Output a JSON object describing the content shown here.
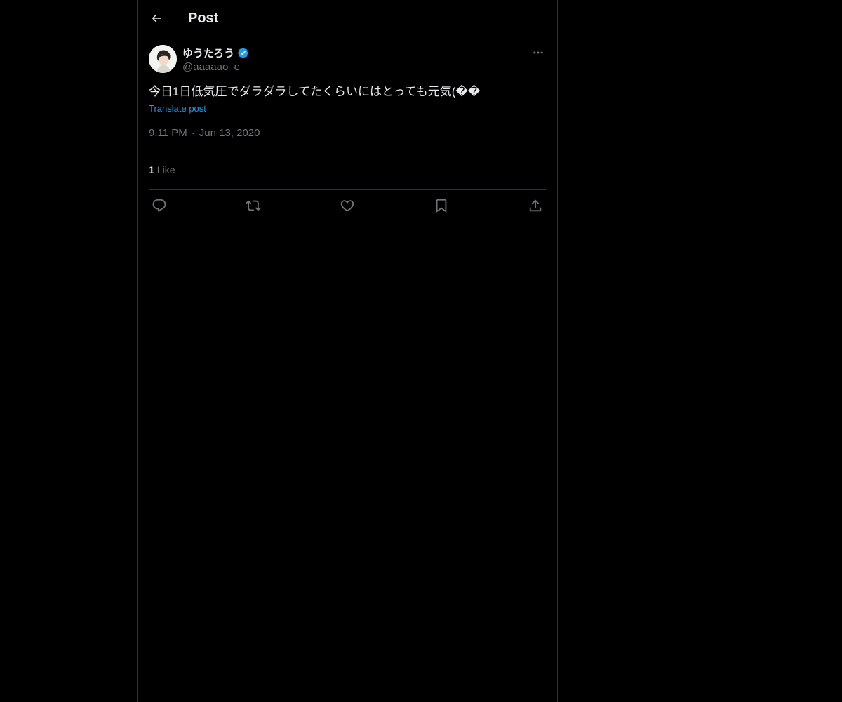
{
  "header": {
    "title": "Post",
    "back_icon": "arrow-left-icon"
  },
  "post": {
    "author": {
      "display_name": "ゆうたろう",
      "handle": "@aaaaao_e",
      "verified": true,
      "verified_color": "#1d9bf0"
    },
    "text": "今日1日低気圧でダラダラしてたくらいにはとっても元気(��",
    "translate_label": "Translate post",
    "time": "9:11 PM",
    "separator": "·",
    "date": "Jun 13, 2020",
    "likes": {
      "count": "1",
      "label": "Like"
    },
    "actions": [
      {
        "name": "reply",
        "icon": "reply-icon"
      },
      {
        "name": "repost",
        "icon": "repost-icon"
      },
      {
        "name": "like",
        "icon": "heart-icon"
      },
      {
        "name": "bookmark",
        "icon": "bookmark-icon"
      },
      {
        "name": "share",
        "icon": "share-icon"
      }
    ]
  },
  "colors": {
    "background": "#000000",
    "text": "#e7e9ea",
    "secondary_text": "#71767b",
    "accent": "#1d9bf0",
    "border": "#2f3336"
  }
}
